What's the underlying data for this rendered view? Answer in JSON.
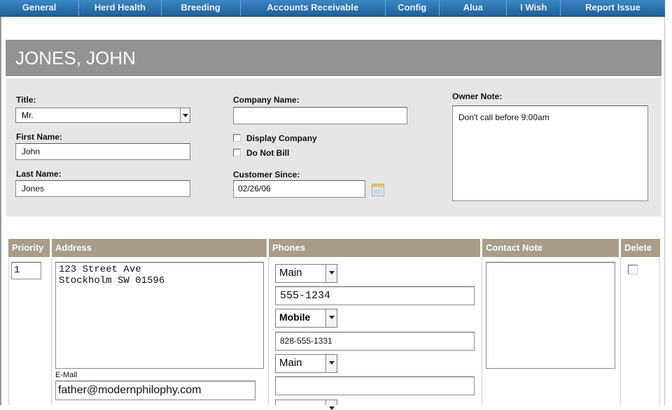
{
  "nav": [
    "General",
    "Herd Health",
    "Breeding",
    "Accounts Receivable",
    "Config",
    "Alua",
    "I Wish",
    "Report Issue"
  ],
  "customer": {
    "name": "JONES, JOHN",
    "title_label": "Title:",
    "title_value": "Mr.",
    "first_name_label": "First Name:",
    "first_name": "John",
    "last_name_label": "Last Name:",
    "last_name": "Jones",
    "company_label": "Company Name:",
    "company_name": "",
    "display_company_label": "Display Company",
    "do_not_bill_label": "Do Not Bill",
    "customer_since_label": "Customer Since:",
    "customer_since": "02/26/06",
    "owner_note_label": "Owner Note:",
    "owner_note": "Don't call before 9:00am"
  },
  "contacts_table": {
    "headers": [
      "Priority",
      "Address",
      "Phones",
      "Contact Note",
      "Delete"
    ],
    "row": {
      "priority": "1",
      "address": "123 Street Ave\nStockholm SW 01596",
      "email_label": "E-Mail",
      "email": "father@modernphilophy.com",
      "phones": [
        {
          "type": "Main",
          "number": "555-1234"
        },
        {
          "type": "Mobile",
          "number": "828-555-1331"
        },
        {
          "type": "Main",
          "number": ""
        }
      ],
      "contact_note": ""
    }
  },
  "icons": {
    "calendar": "calendar-icon",
    "dropdown": "chevron-down-icon"
  }
}
